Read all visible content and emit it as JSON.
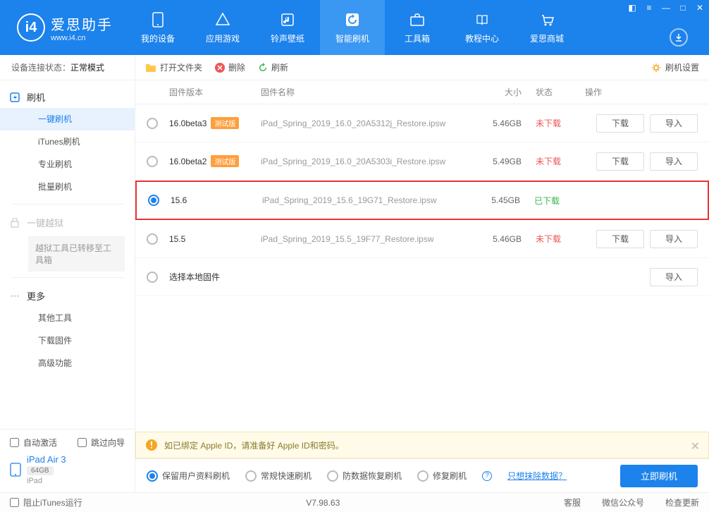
{
  "app": {
    "name": "爱思助手",
    "url": "www.i4.cn"
  },
  "nav": [
    {
      "label": "我的设备"
    },
    {
      "label": "应用游戏"
    },
    {
      "label": "铃声壁纸"
    },
    {
      "label": "智能刷机"
    },
    {
      "label": "工具箱"
    },
    {
      "label": "教程中心"
    },
    {
      "label": "爱思商城"
    }
  ],
  "conn": {
    "prefix": "设备连接状态：",
    "value": "正常模式"
  },
  "sidebar": {
    "group1": "刷机",
    "items1": [
      "一键刷机",
      "iTunes刷机",
      "专业刷机",
      "批量刷机"
    ],
    "group2": "一键越狱",
    "note2": "越狱工具已转移至工具箱",
    "group3": "更多",
    "items3": [
      "其他工具",
      "下载固件",
      "高级功能"
    ]
  },
  "bottom": {
    "auto_activate": "自动激活",
    "skip_guide": "跳过向导",
    "device_name": "iPad Air 3",
    "device_cap": "64GB",
    "device_type": "iPad"
  },
  "toolbar": {
    "open": "打开文件夹",
    "del": "删除",
    "refresh": "刷新",
    "settings": "刷机设置"
  },
  "cols": {
    "c2": "固件版本",
    "c3": "固件名称",
    "c4": "大小",
    "c5": "状态",
    "c6": "操作"
  },
  "rows": [
    {
      "v": "16.0beta3",
      "beta": "测试版",
      "name": "iPad_Spring_2019_16.0_20A5312j_Restore.ipsw",
      "size": "5.46GB",
      "status": "未下载",
      "status_cls": "status-red",
      "sel": false,
      "hl": false,
      "dl": "下载",
      "imp": "导入"
    },
    {
      "v": "16.0beta2",
      "beta": "测试版",
      "name": "iPad_Spring_2019_16.0_20A5303i_Restore.ipsw",
      "size": "5.49GB",
      "status": "未下载",
      "status_cls": "status-red",
      "sel": false,
      "hl": false,
      "dl": "下载",
      "imp": "导入"
    },
    {
      "v": "15.6",
      "beta": "",
      "name": "iPad_Spring_2019_15.6_19G71_Restore.ipsw",
      "size": "5.45GB",
      "status": "已下载",
      "status_cls": "status-green",
      "sel": true,
      "hl": true,
      "dl": "",
      "imp": ""
    },
    {
      "v": "15.5",
      "beta": "",
      "name": "iPad_Spring_2019_15.5_19F77_Restore.ipsw",
      "size": "5.46GB",
      "status": "未下载",
      "status_cls": "status-red",
      "sel": false,
      "hl": false,
      "dl": "下载",
      "imp": "导入"
    }
  ],
  "local_row": {
    "label": "选择本地固件",
    "imp": "导入"
  },
  "alert": "如已绑定 Apple ID，请准备好 Apple ID和密码。",
  "flash": {
    "opts": [
      "保留用户资料刷机",
      "常规快速刷机",
      "防数据恢复刷机",
      "修复刷机"
    ],
    "link": "只想抹除数据？",
    "btn": "立即刷机"
  },
  "statusbar": {
    "block": "阻止iTunes运行",
    "version": "V7.98.63",
    "right": [
      "客服",
      "微信公众号",
      "检查更新"
    ]
  }
}
